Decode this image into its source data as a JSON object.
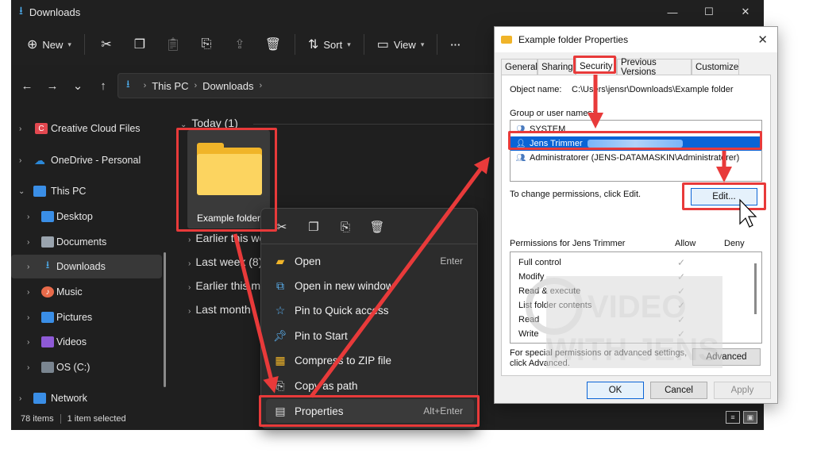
{
  "explorer": {
    "title": "Downloads",
    "window_controls": [
      "—",
      "☐",
      "✕"
    ],
    "toolbar": {
      "new_label": "New",
      "sort_label": "Sort",
      "view_label": "View",
      "more_label": "···"
    },
    "breadcrumb": [
      "This PC",
      "Downloads"
    ],
    "sidebar": [
      {
        "label": "Creative Cloud Files",
        "icon": "creative-cloud-icon"
      },
      {
        "label": "OneDrive - Personal",
        "icon": "onedrive-icon"
      },
      {
        "label": "This PC",
        "icon": "pc-icon"
      },
      {
        "label": "Desktop",
        "icon": "desktop-icon"
      },
      {
        "label": "Documents",
        "icon": "documents-icon"
      },
      {
        "label": "Downloads",
        "icon": "downloads-icon"
      },
      {
        "label": "Music",
        "icon": "music-icon"
      },
      {
        "label": "Pictures",
        "icon": "pictures-icon"
      },
      {
        "label": "Videos",
        "icon": "videos-icon"
      },
      {
        "label": "OS (C:)",
        "icon": "drive-icon"
      },
      {
        "label": "Network",
        "icon": "network-icon"
      }
    ],
    "groups": [
      "Today (1)",
      "Earlier this we",
      "Last week (8)",
      "Earlier this m",
      "Last month"
    ],
    "folder_label": "Example folder",
    "status": {
      "items": "78 items",
      "selected": "1 item selected"
    }
  },
  "context_menu": {
    "items": [
      {
        "label": "Open",
        "shortcut": "Enter",
        "icon": "open-icon"
      },
      {
        "label": "Open in new window",
        "shortcut": "",
        "icon": "new-window-icon"
      },
      {
        "label": "Pin to Quick access",
        "shortcut": "",
        "icon": "star-icon"
      },
      {
        "label": "Pin to Start",
        "shortcut": "",
        "icon": "pin-icon"
      },
      {
        "label": "Compress to ZIP file",
        "shortcut": "",
        "icon": "zip-icon"
      },
      {
        "label": "Copy as path",
        "shortcut": "",
        "icon": "copy-path-icon"
      },
      {
        "label": "Properties",
        "shortcut": "Alt+Enter",
        "icon": "properties-icon"
      }
    ]
  },
  "dialog": {
    "title": "Example folder Properties",
    "tabs": [
      "General",
      "Sharing",
      "Security",
      "Previous Versions",
      "Customize"
    ],
    "object_name_label": "Object name:",
    "object_name_value": "C:\\Users\\jensr\\Downloads\\Example folder",
    "group_label": "Group or user names:",
    "users": [
      "SYSTEM",
      "Jens Trimmer",
      "Administratorer (JENS-DATAMASKIN\\Administratorer)"
    ],
    "change_text": "To change permissions, click Edit.",
    "edit_label": "Edit...",
    "permissions_for": "Permissions for Jens Trimmer",
    "allow_label": "Allow",
    "deny_label": "Deny",
    "permissions": [
      "Full control",
      "Modify",
      "Read & execute",
      "List folder contents",
      "Read",
      "Write"
    ],
    "special_text_1": "For special permissions or advanced settings,",
    "special_text_2": "click Advanced.",
    "advanced_label": "Advanced",
    "ok_label": "OK",
    "cancel_label": "Cancel",
    "apply_label": "Apply"
  },
  "watermark": {
    "line1": "VIDEO",
    "line2": "WITH JENS"
  },
  "colors": {
    "annotation": "#e83a3a",
    "selection": "#0a64d6",
    "folder": "#f0b429"
  }
}
